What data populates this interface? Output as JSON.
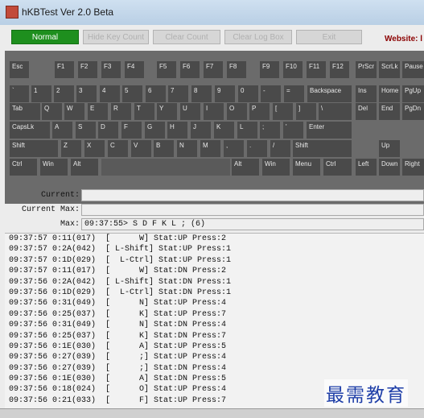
{
  "window": {
    "title": "hKBTest Ver 2.0 Beta"
  },
  "toolbar": {
    "normal": "Normal",
    "hide_key_count": "Hide Key Count",
    "clear_count": "Clear Count",
    "clear_log_box": "Clear Log Box",
    "exit": "Exit",
    "website": "Website: l"
  },
  "keyboard": {
    "keys": [
      "Esc",
      "F1",
      "F2",
      "F3",
      "F4",
      "F5",
      "F6",
      "F7",
      "F8",
      "F9",
      "F10",
      "F11",
      "F12",
      "PrScr",
      "ScrLk",
      "Pause",
      "`",
      "1",
      "2",
      "3",
      "4",
      "5",
      "6",
      "7",
      "8",
      "9",
      "0",
      "-",
      "=",
      "Backspace",
      "Ins",
      "Home",
      "PgUp",
      "Tab",
      "Q",
      "W",
      "E",
      "R",
      "T",
      "Y",
      "U",
      "I",
      "O",
      "P",
      "[",
      "]",
      "\\",
      "Del",
      "End",
      "PgDn",
      "CapsLk",
      "A",
      "S",
      "D",
      "F",
      "G",
      "H",
      "J",
      "K",
      "L",
      ";",
      "'",
      "Enter",
      "Shift",
      "Z",
      "X",
      "C",
      "V",
      "B",
      "N",
      "M",
      ",",
      ".",
      "/",
      "Shift",
      "Up",
      "Ctrl",
      "Win",
      "Alt",
      "Alt",
      "Win",
      "Menu",
      "Ctrl",
      "Left",
      "Down",
      "Right"
    ]
  },
  "status": {
    "current_label": "Current:",
    "current_value": "",
    "current_max_label": "Current Max:",
    "current_max_value": "",
    "max_label": "Max:",
    "max_value": "09:37:55> S D F K L ; (6)"
  },
  "log": [
    "09:37:57 0:11(017)  [      W] Stat:UP Press:2",
    "09:37:57 0:2A(042)  [ L-Shift] Stat:UP Press:1",
    "09:37:57 0:1D(029)  [  L-Ctrl] Stat:UP Press:1",
    "09:37:57 0:11(017)  [      W] Stat:DN Press:2",
    "09:37:56 0:2A(042)  [ L-Shift] Stat:DN Press:1",
    "09:37:56 0:1D(029)  [  L-Ctrl] Stat:DN Press:1",
    "09:37:56 0:31(049)  [      N] Stat:UP Press:4",
    "09:37:56 0:25(037)  [      K] Stat:UP Press:7",
    "09:37:56 0:31(049)  [      N] Stat:DN Press:4",
    "09:37:56 0:25(037)  [      K] Stat:DN Press:7",
    "09:37:56 0:1E(030)  [      A] Stat:UP Press:5",
    "09:37:56 0:27(039)  [      ;] Stat:UP Press:4",
    "09:37:56 0:27(039)  [      ;] Stat:DN Press:4",
    "09:37:56 0:1E(030)  [      A] Stat:DN Press:5",
    "09:37:56 0:18(024)  [      O] Stat:UP Press:4",
    "09:37:56 0:21(033)  [      F] Stat:UP Press:7"
  ],
  "watermark": "最需教育"
}
